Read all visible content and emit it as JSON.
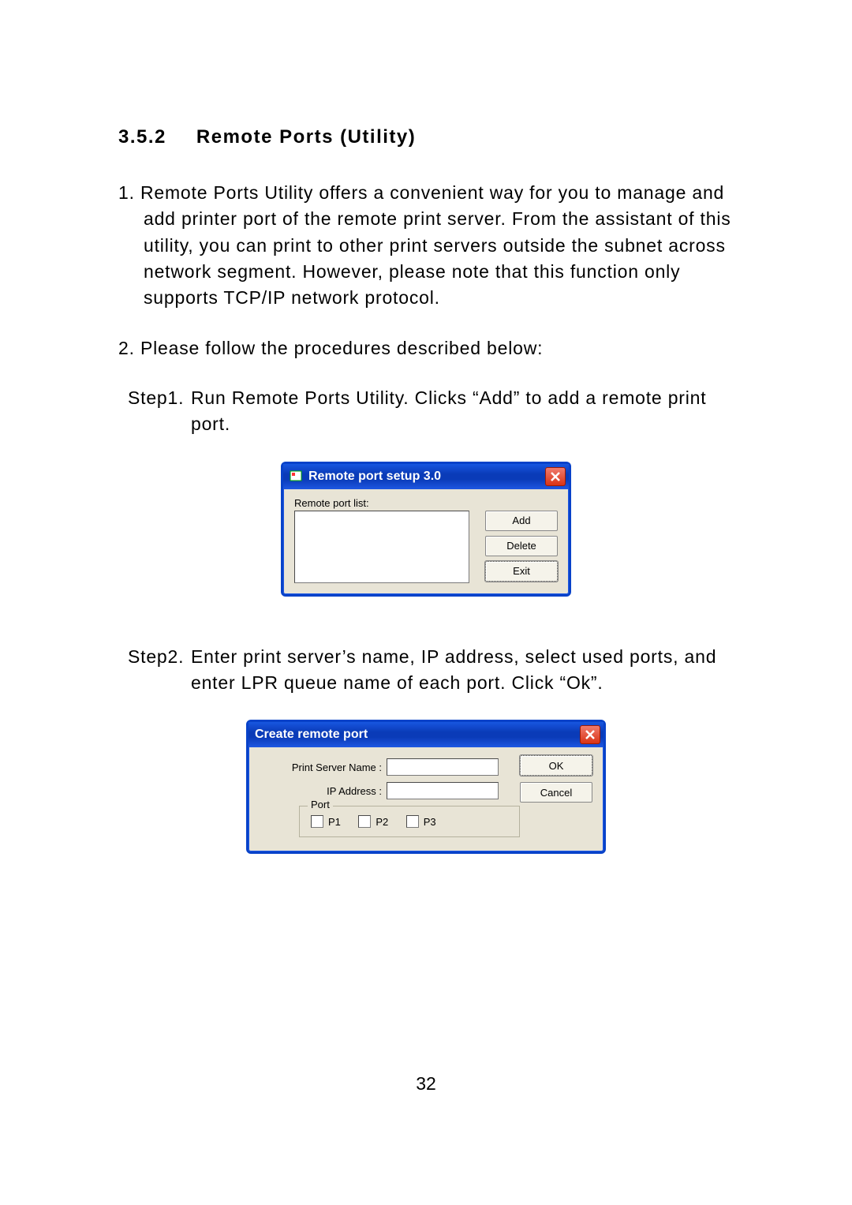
{
  "section": {
    "number": "3.5.2",
    "title": "Remote Ports (Utility)"
  },
  "para1": "1. Remote Ports Utility offers a convenient way for you to manage and add printer port of the remote print server. From the assistant of this utility, you can print to other print servers outside the subnet across network segment. However, please note that this function only supports TCP/IP network protocol.",
  "para2": "2. Please follow the procedures described below:",
  "step1": {
    "label": "Step1.",
    "text": "Run Remote Ports Utility. Clicks “Add” to add a remote print port."
  },
  "step2": {
    "label": "Step2.",
    "text": "Enter print server’s name, IP address, select used ports, and enter LPR queue name of each port. Click “Ok”."
  },
  "dialog1": {
    "title": "Remote port setup 3.0",
    "list_label": "Remote port list:",
    "buttons": {
      "add": "Add",
      "delete": "Delete",
      "exit": "Exit"
    }
  },
  "dialog2": {
    "title": "Create remote port",
    "server_label": "Print Server Name :",
    "ip_label": "IP Address :",
    "port_legend": "Port",
    "ports": {
      "p1": "P1",
      "p2": "P2",
      "p3": "P3"
    },
    "ok": "OK",
    "cancel": "Cancel"
  },
  "page_number": "32"
}
